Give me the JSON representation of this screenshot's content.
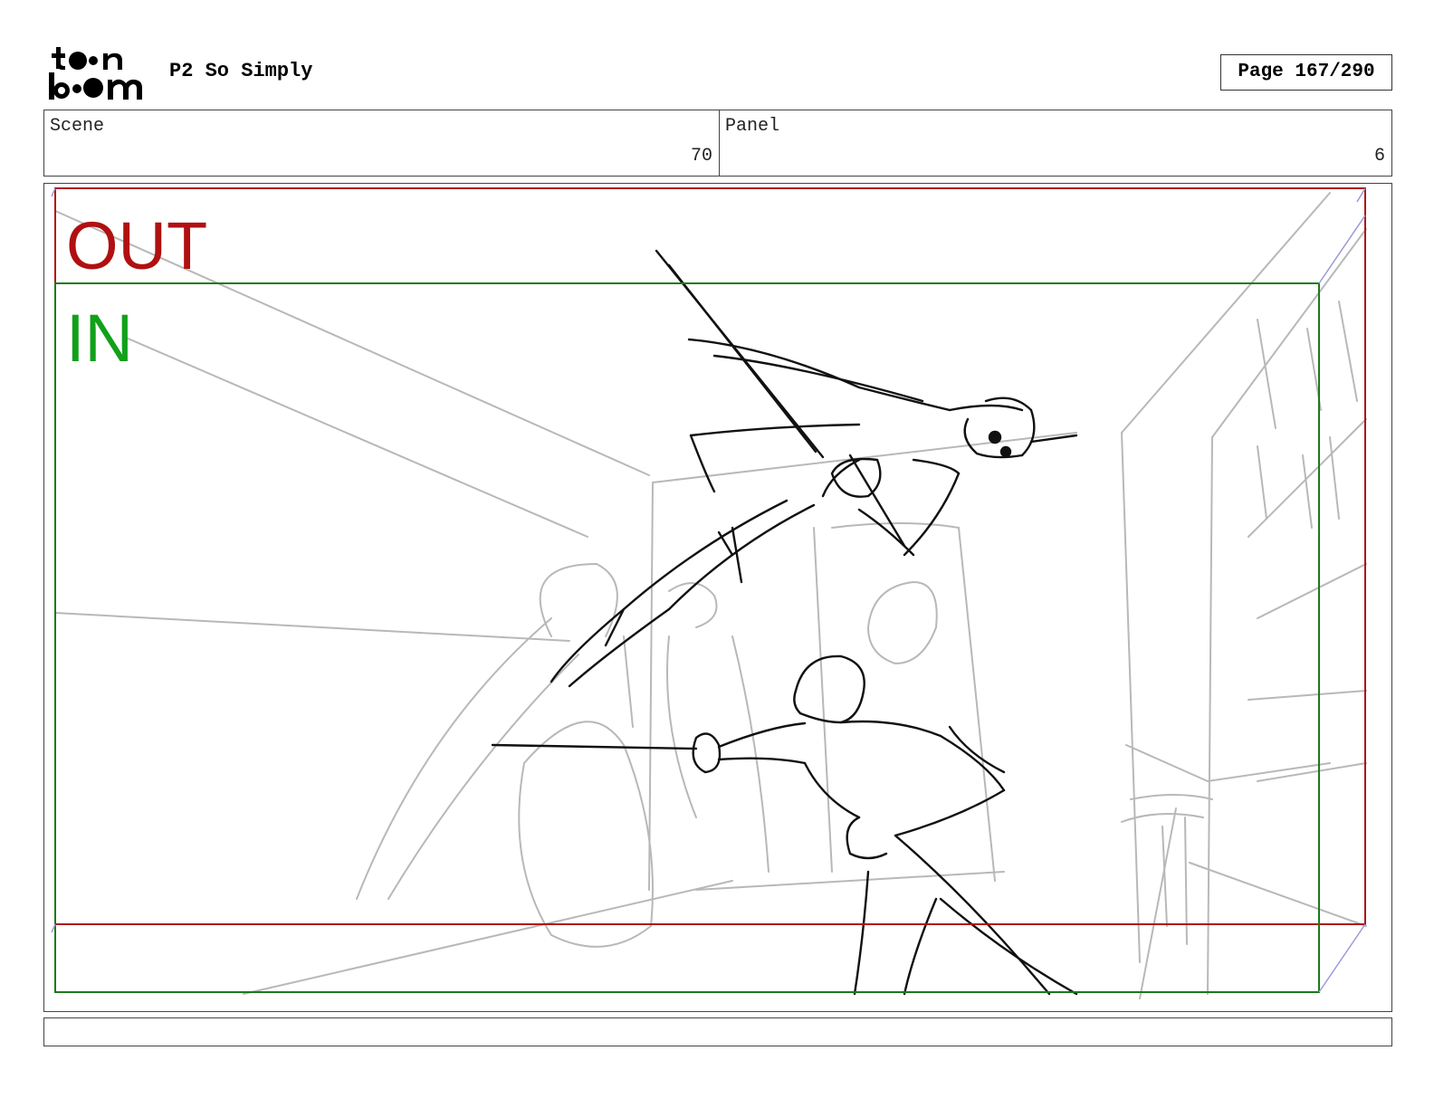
{
  "header": {
    "logo_text": "toon boom",
    "project_title": "P2 So Simply",
    "page_indicator": "Page 167/290"
  },
  "info": {
    "scene_label": "Scene",
    "scene_number": "70",
    "panel_label": "Panel",
    "panel_number": "6"
  },
  "frame": {
    "out_label": "OUT",
    "in_label": "IN",
    "out_color": "#b01010",
    "in_color": "#11a11a",
    "out_frame_color": "#b01010",
    "in_frame_color": "#1a7a1a"
  },
  "notes": {
    "text": ""
  }
}
